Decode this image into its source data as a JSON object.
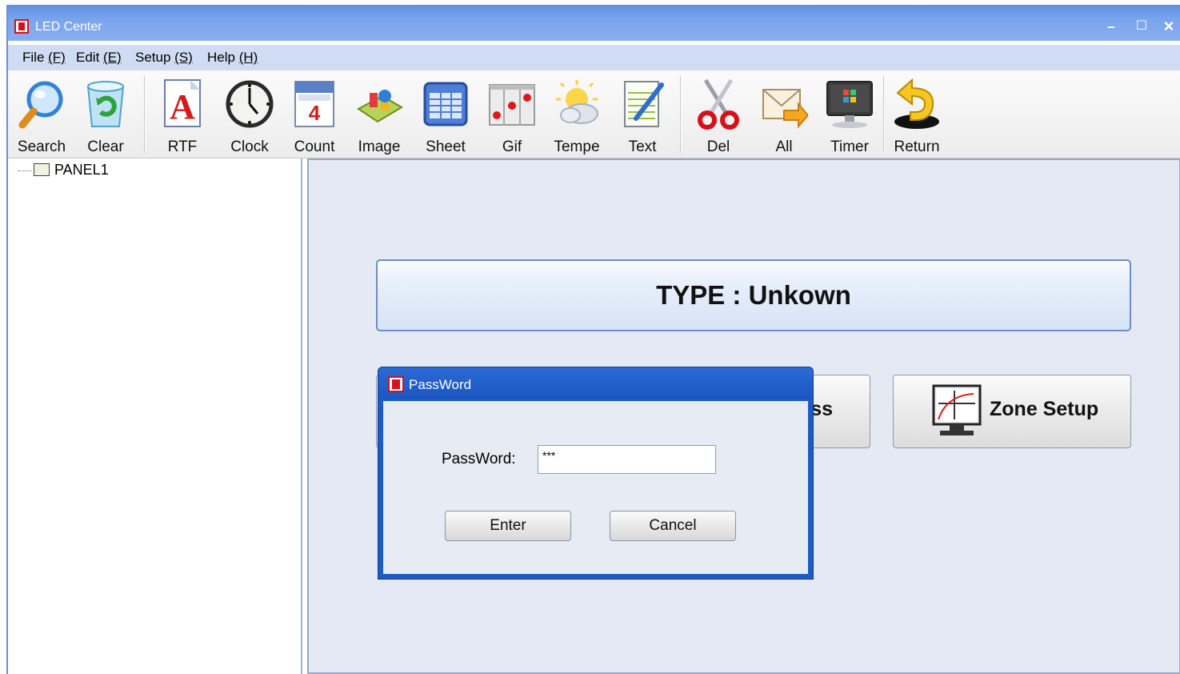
{
  "window": {
    "title": "LED Center",
    "controls": {
      "minimize": "–",
      "maximize": "☐",
      "close": "×"
    }
  },
  "menu": [
    {
      "label": "File",
      "key": "(F)"
    },
    {
      "label": "Edit",
      "key": "(E)"
    },
    {
      "label": "Setup",
      "key": "(S)"
    },
    {
      "label": "Help",
      "key": "(H)"
    }
  ],
  "toolbar": {
    "items": [
      {
        "label": "Search",
        "icon": "magnifier-icon"
      },
      {
        "label": "Clear",
        "icon": "recycle-bin-icon"
      },
      {
        "label": "RTF",
        "icon": "rtf-letter-a-icon"
      },
      {
        "label": "Clock",
        "icon": "clock-icon"
      },
      {
        "label": "Count",
        "icon": "calendar-icon"
      },
      {
        "label": "Image",
        "icon": "image-icon"
      },
      {
        "label": "Sheet",
        "icon": "sheet-icon"
      },
      {
        "label": "Gif",
        "icon": "gif-icon"
      },
      {
        "label": "Tempe",
        "icon": "weather-icon"
      },
      {
        "label": "Text",
        "icon": "notepad-icon"
      },
      {
        "label": "Del",
        "icon": "scissors-icon"
      },
      {
        "label": "All",
        "icon": "mail-icon"
      },
      {
        "label": "Timer",
        "icon": "monitor-icon"
      },
      {
        "label": "Return",
        "icon": "return-arrow-icon"
      }
    ]
  },
  "tree": {
    "root": "PANEL1"
  },
  "main": {
    "type_label": "TYPE : Unkown",
    "hidden_button_suffix": "ss",
    "zone_setup_label": "Zone Setup"
  },
  "dialog": {
    "title": "PassWord",
    "password_label": "PassWord:",
    "password_value": "***",
    "enter_label": "Enter",
    "cancel_label": "Cancel"
  },
  "colors": {
    "titlebar": "#7aa4ec",
    "menubar": "#cfdcf3",
    "dialog_frame": "#1f5bc3",
    "panel_bg": "#e4e9f4",
    "brand_red": "#d8101a"
  }
}
